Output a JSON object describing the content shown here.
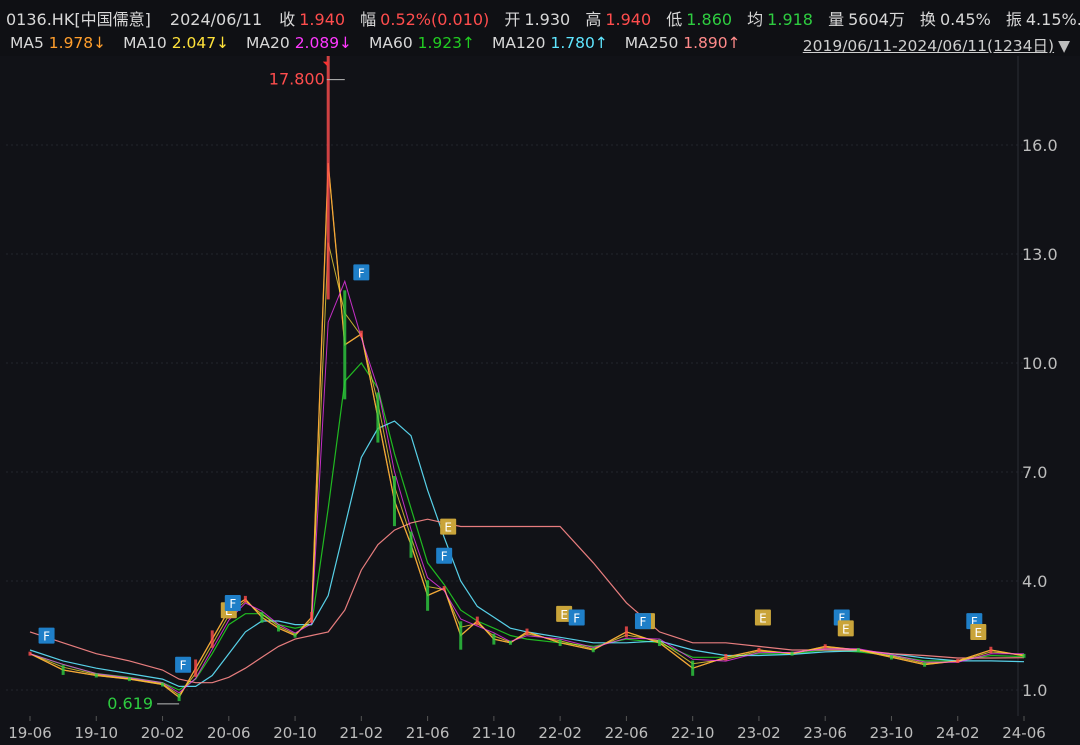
{
  "header": {
    "ticker": "0136.HK[中国儒意]",
    "date": "2024/06/11",
    "close_label": "收",
    "close": "1.940",
    "change_label": "幅",
    "change": "0.52%(0.010)",
    "open_label": "开",
    "open": "1.930",
    "high_label": "高",
    "high": "1.940",
    "low_label": "低",
    "low": "1.860",
    "avg_label": "均",
    "avg": "1.918",
    "volume_label": "量",
    "volume": "5604万",
    "turnover_label": "换",
    "turnover": "0.45%",
    "amplitude_label": "振",
    "amplitude": "4.15%..."
  },
  "ma_bar": {
    "items": [
      {
        "label": "MA5",
        "value": "1.978↓",
        "color": "#ff9e2c"
      },
      {
        "label": "MA10",
        "value": "2.047↓",
        "color": "#ffe23a"
      },
      {
        "label": "MA20",
        "value": "2.089↓",
        "color": "#ff38ff"
      },
      {
        "label": "MA60",
        "value": "1.923↑",
        "color": "#22cc22"
      },
      {
        "label": "MA120",
        "value": "1.780↑",
        "color": "#5fe6ff"
      },
      {
        "label": "MA250",
        "value": "1.890↑",
        "color": "#ff8a8a"
      }
    ],
    "range": "2019/06/11-2024/06/11(1234日)"
  },
  "chart_data": {
    "type": "line",
    "title": "",
    "y_ticks": [
      1.0,
      4.0,
      7.0,
      10.0,
      13.0,
      16.0
    ],
    "y_tick_labels": [
      "1.0",
      "4.0",
      "7.0",
      "10.0",
      "13.0",
      "16.0"
    ],
    "ylim": [
      0.5,
      18.5
    ],
    "x_ticks": [
      "19-06",
      "19-10",
      "20-02",
      "20-06",
      "20-10",
      "21-02",
      "21-06",
      "21-10",
      "22-02",
      "22-06",
      "22-10",
      "23-02",
      "23-06",
      "23-10",
      "24-02",
      "24-06"
    ],
    "grid": true,
    "annotations": [
      {
        "label": "17.800",
        "x": "21-01",
        "y": 17.8,
        "color": "#ff4d4d"
      },
      {
        "label": "0.619",
        "x": "20-03",
        "y": 0.619,
        "color": "#2ecc40"
      }
    ],
    "price": {
      "x": [
        "19-06",
        "19-08",
        "19-10",
        "19-12",
        "20-02",
        "20-03",
        "20-04",
        "20-05",
        "20-06",
        "20-07",
        "20-08",
        "20-09",
        "20-10",
        "20-11",
        "20-12",
        "21-01",
        "21-02",
        "21-03",
        "21-04",
        "21-05",
        "21-06",
        "21-07",
        "21-08",
        "21-09",
        "21-10",
        "21-11",
        "21-12",
        "22-02",
        "22-04",
        "22-06",
        "22-08",
        "22-10",
        "22-12",
        "23-02",
        "23-04",
        "23-06",
        "23-08",
        "23-10",
        "23-12",
        "24-02",
        "24-04",
        "24-06"
      ],
      "y": [
        2.0,
        1.55,
        1.4,
        1.3,
        1.15,
        0.8,
        1.6,
        2.4,
        3.2,
        3.5,
        3.0,
        2.7,
        2.5,
        3.0,
        15.5,
        10.5,
        10.8,
        8.5,
        6.2,
        5.0,
        3.6,
        3.8,
        2.5,
        2.9,
        2.4,
        2.3,
        2.6,
        2.3,
        2.1,
        2.6,
        2.3,
        1.6,
        1.9,
        2.1,
        2.0,
        2.2,
        2.1,
        1.9,
        1.7,
        1.8,
        2.1,
        1.94
      ]
    },
    "series": [
      {
        "name": "MA5",
        "color": "#ff9e2c"
      },
      {
        "name": "MA10",
        "color": "#ffe23a"
      },
      {
        "name": "MA20",
        "color": "#ff38ff"
      },
      {
        "name": "MA60",
        "color": "#22cc22",
        "y": [
          2.0,
          1.7,
          1.45,
          1.35,
          1.2,
          1.0,
          1.3,
          2.0,
          2.8,
          3.1,
          3.1,
          2.8,
          2.7,
          2.8,
          6.0,
          9.5,
          10.0,
          9.3,
          7.5,
          6.0,
          4.5,
          3.9,
          3.2,
          2.9,
          2.7,
          2.5,
          2.4,
          2.3,
          2.2,
          2.4,
          2.3,
          1.9,
          1.9,
          2.0,
          2.0,
          2.1,
          2.05,
          1.95,
          1.8,
          1.8,
          1.95,
          1.92
        ]
      },
      {
        "name": "MA120",
        "color": "#5fe6ff",
        "y": [
          2.1,
          1.8,
          1.6,
          1.45,
          1.3,
          1.1,
          1.1,
          1.4,
          2.0,
          2.6,
          2.9,
          2.9,
          2.8,
          2.8,
          3.6,
          5.5,
          7.4,
          8.2,
          8.4,
          8.0,
          6.5,
          5.2,
          4.0,
          3.3,
          3.0,
          2.7,
          2.6,
          2.45,
          2.3,
          2.3,
          2.35,
          2.1,
          1.95,
          1.95,
          1.98,
          2.05,
          2.08,
          2.0,
          1.88,
          1.8,
          1.8,
          1.78
        ]
      },
      {
        "name": "MA250",
        "color": "#ff8a8a",
        "y": [
          2.6,
          2.3,
          2.0,
          1.8,
          1.55,
          1.3,
          1.2,
          1.2,
          1.35,
          1.6,
          1.9,
          2.2,
          2.4,
          2.5,
          2.6,
          3.2,
          4.3,
          5.0,
          5.4,
          5.6,
          5.7,
          5.6,
          5.5,
          5.5,
          5.5,
          5.5,
          5.5,
          5.5,
          4.5,
          3.4,
          2.6,
          2.3,
          2.3,
          2.2,
          2.1,
          2.1,
          2.1,
          2.0,
          1.95,
          1.88,
          1.88,
          1.89
        ]
      }
    ],
    "markers": [
      {
        "x": "19-07",
        "y": 2.0,
        "label": "F"
      },
      {
        "x": "20-03",
        "y": 1.2,
        "label": "F"
      },
      {
        "x": "20-06",
        "y": 2.7,
        "label": "E"
      },
      {
        "x": "20-06",
        "y": 2.9,
        "label": "F"
      },
      {
        "x": "21-02",
        "y": 12.0,
        "label": "F"
      },
      {
        "x": "21-07",
        "y": 5.0,
        "label": "E"
      },
      {
        "x": "21-07",
        "y": 4.2,
        "label": "F"
      },
      {
        "x": "22-02",
        "y": 2.6,
        "label": "E"
      },
      {
        "x": "22-03",
        "y": 2.5,
        "label": "F"
      },
      {
        "x": "22-07",
        "y": 2.4,
        "label": "E"
      },
      {
        "x": "22-07",
        "y": 2.4,
        "label": "F"
      },
      {
        "x": "23-02",
        "y": 2.5,
        "label": "E"
      },
      {
        "x": "23-07",
        "y": 2.5,
        "label": "F"
      },
      {
        "x": "23-07",
        "y": 2.2,
        "label": "E"
      },
      {
        "x": "24-03",
        "y": 2.4,
        "label": "F"
      },
      {
        "x": "24-03",
        "y": 2.1,
        "label": "E"
      }
    ]
  }
}
